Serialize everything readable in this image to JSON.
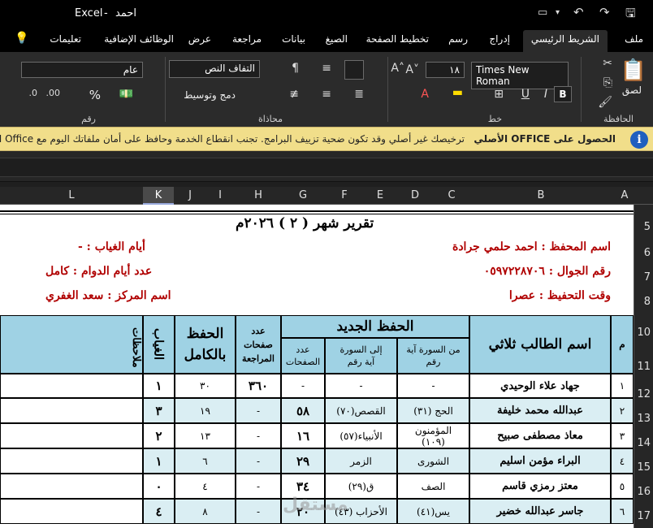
{
  "titlebar": {
    "app": "Excel",
    "sep": "-",
    "doc": "احمد"
  },
  "tabs": [
    "ملف",
    "الشريط الرئيسي",
    "إدراج",
    "رسم",
    "تخطيط الصفحة",
    "الصيغ",
    "بيانات",
    "مراجعة",
    "عرض",
    "الوظائف الإضافية",
    "تعليمات"
  ],
  "ribbon": {
    "clipboard": {
      "paste": "لصق",
      "label": "الحافظة"
    },
    "font": {
      "name": "Times New Roman",
      "size": "١٨",
      "label": "خط",
      "bold": "B"
    },
    "alignment": {
      "wrap": "التفاف النص",
      "merge": "دمج وتوسيط",
      "label": "محاذاة"
    },
    "number": {
      "format": "عام",
      "percent": "%",
      "label": "رقم"
    }
  },
  "message": {
    "strong": "الحصول على OFFICE الأصلي",
    "body": "ترخيصك غير أصلي وقد تكون ضحية تزييف البرامج. تجنب انقطاع الخدمة وحافظ على أمان ملفاتك اليوم مع Office الأصلي."
  },
  "columns": [
    "A",
    "B",
    "C",
    "D",
    "E",
    "F",
    "G",
    "H",
    "I",
    "J",
    "K",
    "L"
  ],
  "rows": [
    "5",
    "6",
    "7",
    "8",
    "10",
    "11",
    "12",
    "13",
    "14",
    "15",
    "16",
    "17"
  ],
  "sheet": {
    "title": "تقرير شهر ( ٢ ) ٢٠٢٦م",
    "left_info": [
      "أيام الغياب : -",
      "عدد أيام الدوام : كامل",
      "اسم المركز : سعد الغفري"
    ],
    "right_info": [
      "اسم المحفظ : احمد حلمي جرادة",
      "رقم الجوال : ٠٥٩٧٢٢٨٧٠٦",
      "وقت التحفيظ : عصرا"
    ]
  },
  "table": {
    "headers": {
      "m": "م",
      "name": "اسم الطالب ثلاثي",
      "new": "الحفظ الجديد",
      "from": "من السورة آية رقم",
      "to": "إلى السورة آية رقم",
      "pages": "عدد الصفحات",
      "review": "عدد صفحات المراجعة",
      "full": "الحفظ بالكامل",
      "absence": "الغياب",
      "notes": "ملاحظات"
    },
    "rows": [
      {
        "m": "١",
        "name": "جهاد علاء الوحيدي",
        "from": "-",
        "to": "-",
        "pages": "-",
        "review": "٣٦٠",
        "full": "٣٠",
        "absence": "١"
      },
      {
        "m": "٢",
        "name": "عبدالله محمد خليفة",
        "from": "الحج (٣١)",
        "to": "القصص(٧٠)",
        "pages": "٥٨",
        "review": "-",
        "full": "١٩",
        "absence": "٣"
      },
      {
        "m": "٣",
        "name": "معاذ مصطفى صبيح",
        "from": "المؤمنون (١٠٩)",
        "to": "الأنبياء(٥٧)",
        "pages": "١٦",
        "review": "-",
        "full": "١٣",
        "absence": "٢"
      },
      {
        "m": "٤",
        "name": "البراء مؤمن اسليم",
        "from": "الشورى",
        "to": "الزمر",
        "pages": "٢٩",
        "review": "-",
        "full": "٦",
        "absence": "١"
      },
      {
        "m": "٥",
        "name": "معتز رمزي قاسم",
        "from": "الصف",
        "to": "ق(٢٩)",
        "pages": "٣٤",
        "review": "-",
        "full": "٤",
        "absence": "٠"
      },
      {
        "m": "٦",
        "name": "جاسر عبدالله خضير",
        "from": "يس(٤١)",
        "to": "الأحزاب (٤٣)",
        "pages": "٢٠",
        "review": "-",
        "full": "٨",
        "absence": "٤"
      }
    ]
  },
  "watermark": "مستقل"
}
